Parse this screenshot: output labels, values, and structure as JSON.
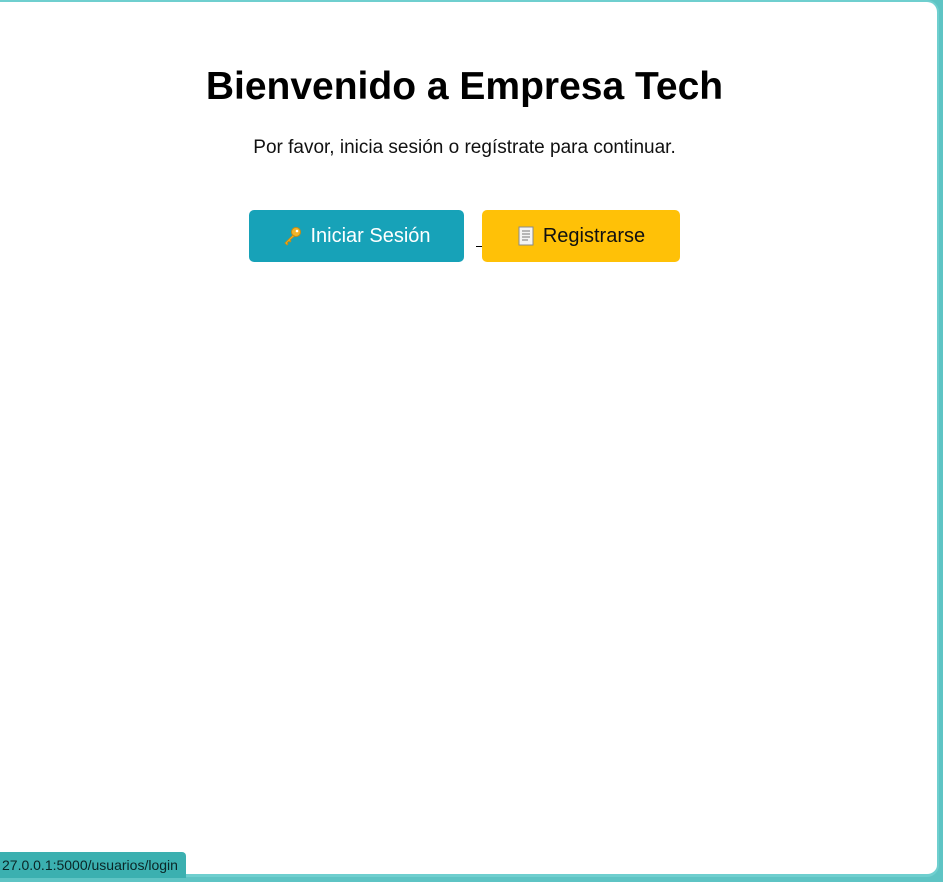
{
  "header": {
    "title": "Bienvenido a Empresa Tech",
    "subtitle": "Por favor, inicia sesión o regístrate para continuar."
  },
  "actions": {
    "login": {
      "label": "Iniciar Sesión",
      "icon": "key-icon",
      "color": "#17a2b8"
    },
    "register": {
      "label": "Registrarse",
      "icon": "document-icon",
      "color": "#ffc107"
    }
  },
  "status_bar": {
    "url": "27.0.0.1:5000/usuarios/login"
  }
}
